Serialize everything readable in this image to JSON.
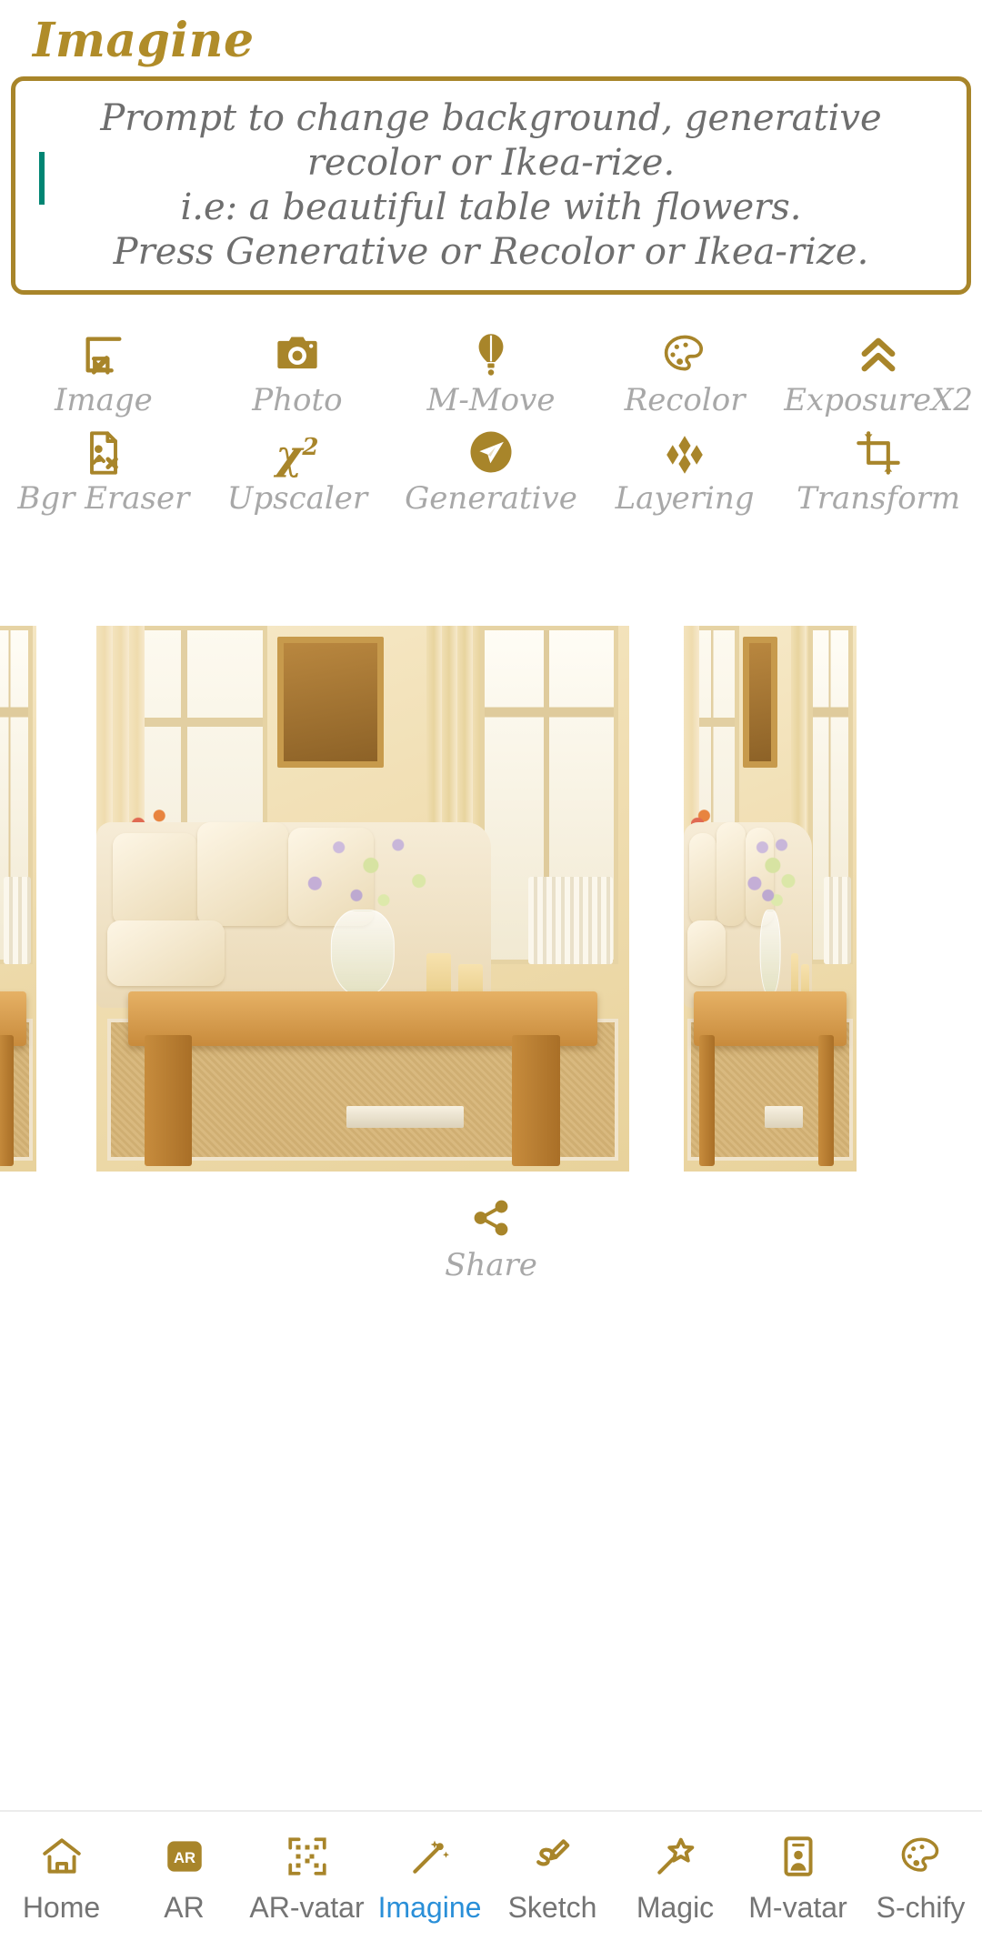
{
  "header": {
    "title": "Imagine"
  },
  "prompt": {
    "value": "",
    "placeholder": "Prompt to change background, generative\nrecolor or Ikea-rize.\ni.e: a beautiful table with flowers.\nPress Generative or Recolor or Ikea-rize.",
    "caret_color": "#008573",
    "border_color": "#a8852a"
  },
  "theme": {
    "gold": "#a8852a",
    "title_gold": "#b08c29",
    "label_gray": "#a8a8a8",
    "nav_gray": "#747474",
    "active_blue": "#2a8fd8"
  },
  "tools": {
    "row1": [
      {
        "label": "Image",
        "icon": "image-import-icon"
      },
      {
        "label": "Photo",
        "icon": "camera-icon"
      },
      {
        "label": "M-Move",
        "icon": "hot-air-balloon-icon"
      },
      {
        "label": "Recolor",
        "icon": "palette-icon"
      },
      {
        "label": "ExposureX2",
        "icon": "double-chevron-up-icon"
      }
    ],
    "row2": [
      {
        "label": "Bgr Eraser",
        "icon": "document-remove-icon"
      },
      {
        "label": "Upscaler",
        "icon": "x-squared-icon",
        "glyph": "x",
        "exponent": "2"
      },
      {
        "label": "Generative",
        "icon": "paper-plane-icon"
      },
      {
        "label": "Layering",
        "icon": "diamonds-icon"
      },
      {
        "label": "Transform",
        "icon": "crop-transform-icon"
      }
    ]
  },
  "share": {
    "label": "Share",
    "icon": "share-nodes-icon"
  },
  "bottom_nav": {
    "active": "Imagine",
    "items": [
      {
        "label": "Home",
        "icon": "home-icon",
        "active": false
      },
      {
        "label": "AR",
        "icon": "ar-badge-icon",
        "active": false
      },
      {
        "label": "AR-vatar",
        "icon": "qr-code-icon",
        "active": false
      },
      {
        "label": "Imagine",
        "icon": "magic-wand-sparkle-icon",
        "active": true
      },
      {
        "label": "Sketch",
        "icon": "pencil-sketch-icon",
        "active": false
      },
      {
        "label": "Magic",
        "icon": "magic-star-wand-icon",
        "active": false
      },
      {
        "label": "M-vatar",
        "icon": "id-card-person-icon",
        "active": false
      },
      {
        "label": "S-chify",
        "icon": "palette-icon",
        "active": false
      }
    ]
  },
  "carousel": {
    "slides": [
      {
        "alt": "living room with wooden coffee table - previous"
      },
      {
        "alt": "living room with rustic wooden coffee table, sofa, flowers"
      },
      {
        "alt": "living room with wooden coffee table - next"
      }
    ],
    "active_index": 1
  }
}
